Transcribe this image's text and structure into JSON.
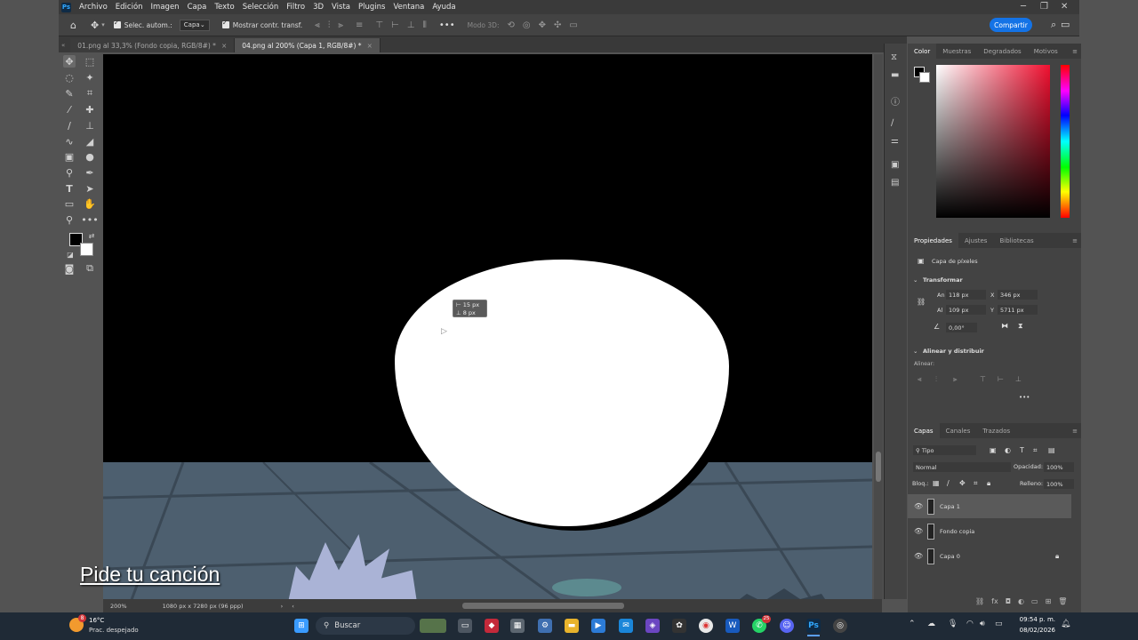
{
  "menubar": {
    "logo": "Ps",
    "items": [
      "Archivo",
      "Edición",
      "Imagen",
      "Capa",
      "Texto",
      "Selección",
      "Filtro",
      "3D",
      "Vista",
      "Plugins",
      "Ventana",
      "Ayuda"
    ]
  },
  "options": {
    "auto_select_label": "Selec. autom.:",
    "auto_select_value": "Capa",
    "show_transform_label": "Mostrar contr. transf.",
    "mode3d_label": "Modo 3D:",
    "share_label": "Compartir"
  },
  "tabs": [
    {
      "label": "01.png al 33,3% (Fondo copia, RGB/8#) *",
      "active": false
    },
    {
      "label": "04.png al 200% (Capa 1, RGB/8#) *",
      "active": true
    }
  ],
  "canvas": {
    "measure_w": "15 px",
    "measure_h": "8 px",
    "caption": "Pide tu canción"
  },
  "status": {
    "zoom": "200%",
    "doc_info": "1080 px x 7280 px (96 ppp)"
  },
  "color_panel": {
    "tabs": [
      "Color",
      "Muestras",
      "Degradados",
      "Motivos"
    ],
    "foreground": "#000000",
    "background": "#ffffff"
  },
  "properties": {
    "tabs": [
      "Propiedades",
      "Ajustes",
      "Bibliotecas"
    ],
    "layer_type": "Capa de píxeles",
    "transform_header": "Transformar",
    "w_label": "An",
    "w_value": "118 px",
    "x_label": "X",
    "x_value": "346 px",
    "h_label": "Al",
    "h_value": "109 px",
    "y_label": "Y",
    "y_value": "5711 px",
    "angle_value": "0,00°",
    "align_header": "Alinear y distribuir",
    "align_label": "Alinear:"
  },
  "layers_panel": {
    "tabs": [
      "Capas",
      "Canales",
      "Trazados"
    ],
    "filter_value": "Tipo",
    "blend_mode": "Normal",
    "opacity_label": "Opacidad:",
    "opacity_value": "100%",
    "lock_label": "Bloq.:",
    "fill_label": "Relleno:",
    "fill_value": "100%",
    "layers": [
      {
        "name": "Capa 1",
        "selected": true,
        "locked": false
      },
      {
        "name": "Fondo copia",
        "selected": false,
        "locked": false
      },
      {
        "name": "Capa 0",
        "selected": false,
        "locked": true
      }
    ]
  },
  "taskbar": {
    "weather_temp": "16°C",
    "weather_desc": "Prac. despejado",
    "search_label": "Buscar",
    "time": "09:54 p. m.",
    "date": "08/02/2026",
    "weather_badge": "8",
    "whatsapp_badge": "25"
  },
  "colors": {
    "accent": "#1473e6",
    "panel_bg": "#434343",
    "workspace_bg": "#535353"
  }
}
